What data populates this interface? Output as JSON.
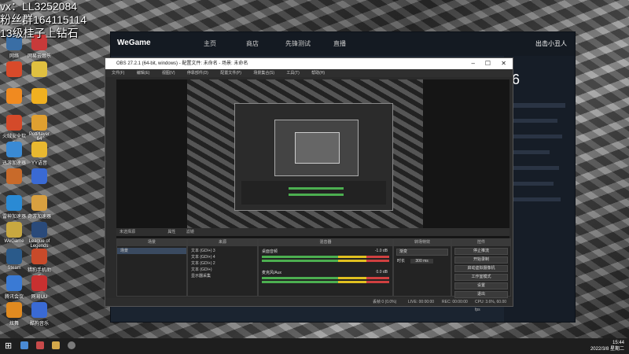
{
  "overlay": {
    "line1": "vx：LL3252084",
    "line2": "粉丝群164115114",
    "line3": "13级桂子上钻石"
  },
  "desktop_icons": [
    "网络",
    "网易云音乐",
    "",
    "",
    "",
    "",
    "火绒安全软件",
    "PotPlayer 64",
    "迅游加速器",
    "YY语音",
    "",
    "",
    "雷神加速器",
    "奇游加速器",
    "WeGame",
    "League of Legends",
    "Steam",
    "猎豹手机助手",
    "腾讯会议",
    "网易UU",
    "炫舞",
    "酷狗音乐"
  ],
  "wegame": {
    "logo": "WeGame",
    "nav": [
      "主页",
      "商店",
      "先锋测试",
      "直播"
    ],
    "user": "出击小丑人"
  },
  "obs": {
    "title": "OBS 27.2.1 (64-bit, windows) - 配置文件: 未命名 - 场景: 未命名",
    "menu": [
      "文件(F)",
      "编辑(E)",
      "视图(V)",
      "停靠部件(D)",
      "配置文件(P)",
      "场景集合(S)",
      "工具(T)",
      "帮助(H)"
    ],
    "no_source": "未选择源",
    "props": "属性",
    "filters": "滤镜",
    "panels": {
      "scenes": "场景",
      "sources": "来源",
      "mixer": "混音器",
      "transitions": "转场特效",
      "controls": "控件"
    },
    "scene_item": "场景",
    "sources": [
      "文本 (GDI+) 3",
      "文本 (GDI+) 4",
      "文本 (GDI+) 2",
      "文本 (GDI+)",
      "显示器采集"
    ],
    "mixer": [
      {
        "name": "桌面音频",
        "db": "-1.0 dB"
      },
      {
        "name": "麦克风/Aux",
        "db": "0.0 dB"
      }
    ],
    "transition": {
      "type": "渐变",
      "duration_label": "时长",
      "duration": "300 ms"
    },
    "controls": [
      "停止推流",
      "开始录制",
      "启动虚拟摄像机",
      "工作室模式",
      "设置",
      "退出"
    ],
    "status": {
      "dropped": "丢帧 0 (0.0%)",
      "live": "LIVE: 00:00:00",
      "rec": "REC: 00:00:00",
      "cpu": "CPU: 3.6%, 60.00 fps"
    }
  },
  "taskbar": {
    "time": "15:44",
    "date": "2022/3/8 星期二"
  }
}
